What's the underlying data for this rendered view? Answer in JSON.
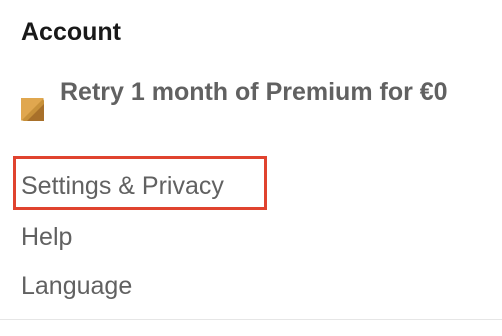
{
  "account": {
    "title": "Account",
    "premium": {
      "label": "Retry 1 month of Premium for €0",
      "icon": "premium-gold-icon",
      "icon_colors": [
        "#c8913a",
        "#e0a74f",
        "#a8702a"
      ]
    },
    "menu": {
      "settings_label": "Settings & Privacy",
      "help_label": "Help",
      "language_label": "Language"
    }
  },
  "colors": {
    "heading": "#191919",
    "text": "#616161",
    "highlight": "#e0432f",
    "divider": "#e6e6e6"
  }
}
